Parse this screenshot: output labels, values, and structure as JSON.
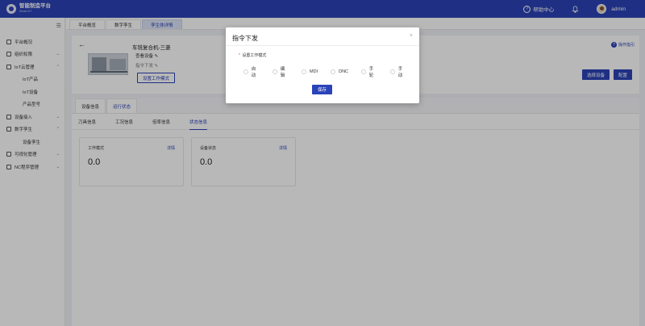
{
  "topbar": {
    "logo_title": "智能制造平台",
    "logo_sub": "Smart IoT",
    "help_label": "帮助中心",
    "username": "admin"
  },
  "sidebar": {
    "items": [
      {
        "label": "平台概况",
        "chevron": ""
      },
      {
        "label": "组织权限",
        "chevron": "⌄"
      },
      {
        "label": "IoT云管理",
        "chevron": "⌃"
      },
      {
        "label": "IoT产品",
        "chevron": ""
      },
      {
        "label": "IoT设备",
        "chevron": ""
      },
      {
        "label": "产品型号",
        "chevron": ""
      },
      {
        "label": "设备接入",
        "chevron": "⌄"
      },
      {
        "label": "数字孪生",
        "chevron": "⌃"
      },
      {
        "label": "设备孪生",
        "chevron": ""
      },
      {
        "label": "可视化管理",
        "chevron": "⌄"
      },
      {
        "label": "NC程序管理",
        "chevron": "⌄"
      }
    ]
  },
  "page_tabs": [
    "平台概览",
    "数字孪生",
    "孪生体详情"
  ],
  "device": {
    "name": "车铣复合机-三菱",
    "view_device": "查看设备",
    "cmd_send": "指令下发",
    "set_mode_button": "设置工作模式",
    "op_guide": "操作指引",
    "select_device_button": "选择设备",
    "config_button": "配置"
  },
  "main_tabs": [
    "设备信息",
    "运行状态"
  ],
  "sub_tabs": [
    "刀具信息",
    "工况信息",
    "倍率信息",
    "状态信息"
  ],
  "stats": [
    {
      "title": "工作模式",
      "detail": "详情",
      "value": "0.0"
    },
    {
      "title": "设备状态",
      "detail": "详情",
      "value": "0.0"
    }
  ],
  "modal": {
    "title": "指令下发",
    "close": "×",
    "required_mark": "*",
    "field_label": "设置工作模式",
    "options": [
      "自动",
      "编辑",
      "MDI",
      "DNC",
      "手轮",
      "手动"
    ],
    "save_button": "保存"
  },
  "colors": {
    "brand": "#2b43b8",
    "overlay": "rgba(0,0,0,0.28)"
  }
}
